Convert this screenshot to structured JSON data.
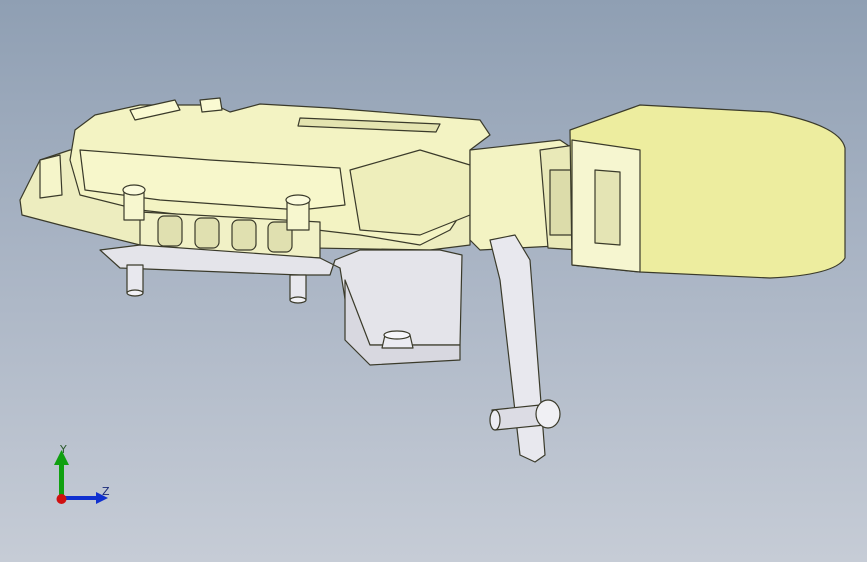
{
  "viewer": {
    "background_top": "#8f9fb3",
    "background_bottom": "#c6ccd6",
    "model_color": "#f2f2c0",
    "model_edge_color": "#3a3a2a",
    "bracket_color": "#e8e8ee"
  },
  "triad": {
    "y_label": "Y",
    "z_label": "Z",
    "x_axis_color": "#d01010",
    "y_axis_color": "#10a010",
    "z_axis_color": "#1030d0"
  }
}
